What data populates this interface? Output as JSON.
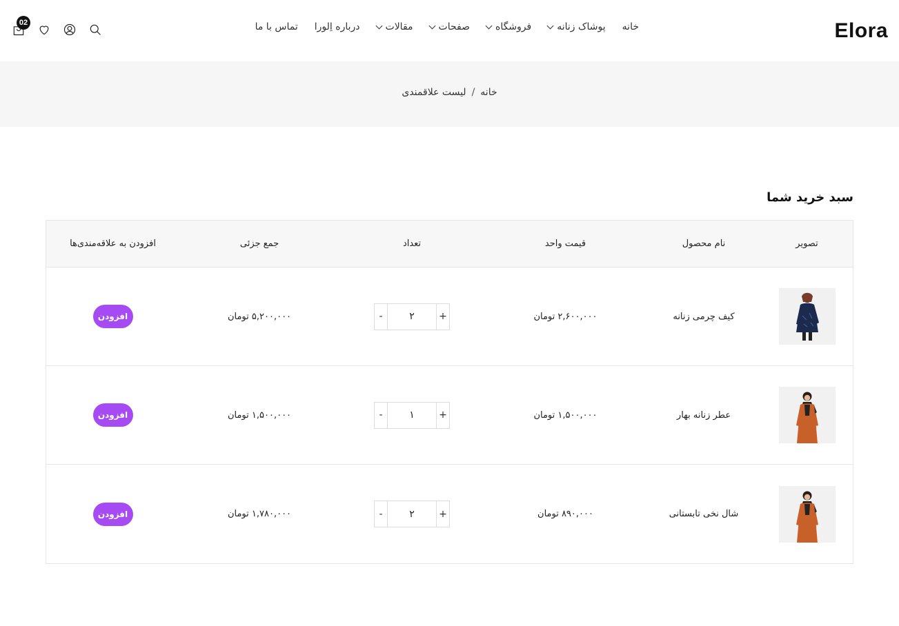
{
  "header": {
    "logo": "Elora",
    "nav": [
      {
        "label": "خانه",
        "dropdown": false
      },
      {
        "label": "پوشاک زنانه",
        "dropdown": true
      },
      {
        "label": "فروشگاه",
        "dropdown": true
      },
      {
        "label": "صفحات",
        "dropdown": true
      },
      {
        "label": "مقالات",
        "dropdown": true
      },
      {
        "label": "درباره اِلورا",
        "dropdown": false
      },
      {
        "label": "تماس با ما",
        "dropdown": false
      }
    ],
    "cart_count": "02"
  },
  "breadcrumb": {
    "home": "خانه",
    "separator": "/",
    "current": "لیست علاقمندی"
  },
  "cart": {
    "title": "سبد خرید شما",
    "columns": {
      "image": "تصویر",
      "name": "نام محصول",
      "unit_price": "قیمت واحد",
      "quantity": "تعداد",
      "subtotal": "جمع جزئی",
      "add_to_wishlist": "افزودن به علاقه‌مندی‌ها"
    },
    "items": [
      {
        "name": "کیف چرمی زنانه",
        "unit_price": "۲,۶۰۰,۰۰۰ تومان",
        "quantity": "۲",
        "subtotal": "۵,۲۰۰,۰۰۰ تومان",
        "add_label": "افزودن",
        "image": "woman-navy-coat"
      },
      {
        "name": "عطر زنانه بهار",
        "unit_price": "۱,۵۰۰,۰۰۰ تومان",
        "quantity": "۱",
        "subtotal": "۱,۵۰۰,۰۰۰ تومان",
        "add_label": "افزودن",
        "image": "woman-orange-coat"
      },
      {
        "name": "شال نخی تابستانی",
        "unit_price": "۸۹۰,۰۰۰ تومان",
        "quantity": "۲",
        "subtotal": "۱,۷۸۰,۰۰۰ تومان",
        "add_label": "افزودن",
        "image": "woman-orange-coat"
      }
    ],
    "qty_minus": "-",
    "qty_plus": "+"
  },
  "colors": {
    "accent": "#a64bf4",
    "band": "#f6f6f6",
    "navy_coat": "#1c2a4e",
    "orange_coat": "#c8602a"
  }
}
